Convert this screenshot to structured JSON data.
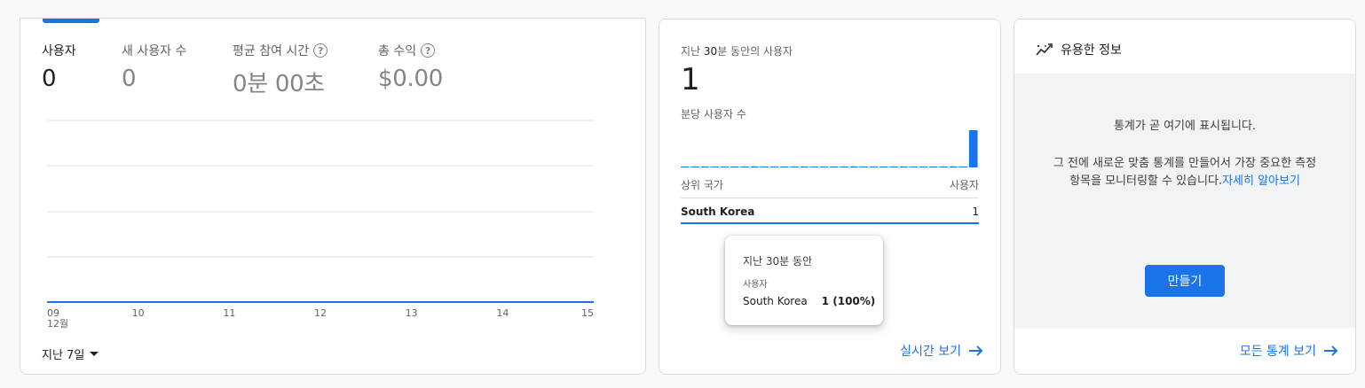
{
  "overview": {
    "metrics": [
      {
        "label": "사용자",
        "value": "0",
        "active": true,
        "help": false
      },
      {
        "label": "새 사용자 수",
        "value": "0",
        "active": false,
        "help": false
      },
      {
        "label": "평균 참여 시간",
        "value": "0분 00초",
        "active": false,
        "help": true
      },
      {
        "label": "총 수익",
        "value": "$0.00",
        "active": false,
        "help": true
      }
    ],
    "date_range_label": "지난 7일"
  },
  "chart_data": {
    "type": "line",
    "x": [
      "09",
      "10",
      "11",
      "12",
      "13",
      "14",
      "15"
    ],
    "x_sublabel": "12월",
    "series": [
      {
        "values": [
          0,
          0,
          0,
          0,
          0,
          0,
          0
        ],
        "color": "#1a73e8"
      }
    ],
    "grid": true
  },
  "realtime": {
    "title_prefix": "지난 30분 동안의 사용자",
    "title_bold": "30",
    "count": "1",
    "per_minute_label": "분당 사용자 수",
    "per_minute_values": [
      0,
      0,
      0,
      0,
      0,
      0,
      0,
      0,
      0,
      0,
      0,
      0,
      0,
      0,
      0,
      0,
      0,
      0,
      0,
      0,
      0,
      0,
      0,
      0,
      0,
      0,
      0,
      0,
      0,
      1
    ],
    "table_header_left": "상위 국가",
    "table_header_right": "사용자",
    "rows": [
      {
        "country": "South Korea",
        "users": "1"
      }
    ],
    "footer_link": "실시간 보기"
  },
  "tooltip": {
    "title": "지난 30분 동안",
    "metric": "사용자",
    "country": "South Korea",
    "value": "1 (100%)"
  },
  "insights": {
    "title": "유용한 정보",
    "message_1": "통계가 곧 여기에 표시됩니다.",
    "message_2a": "그 전에 새로운 맞춤 통계를 만들어서 가장 중요한 측정",
    "message_2b": "항목을 모니터링할 수 있습니다.",
    "learn_more": "자세히 알아보기",
    "create_button": "만들기",
    "footer_link": "모든 통계 보기"
  },
  "colors": {
    "accent": "#1a73e8",
    "grid": "#e0e0e0"
  }
}
